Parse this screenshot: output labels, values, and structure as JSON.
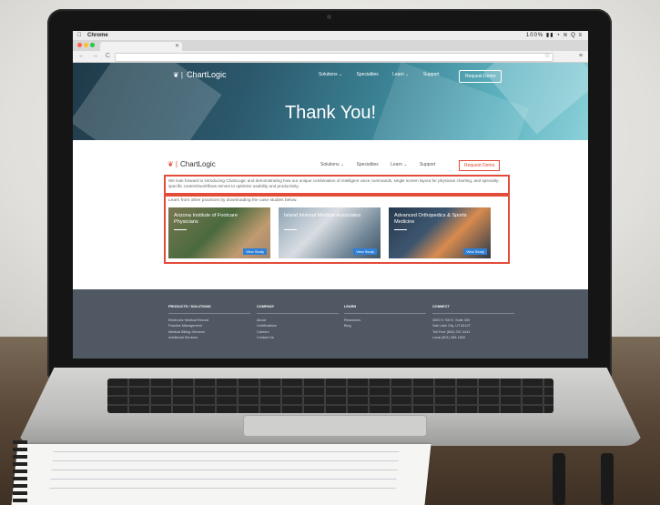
{
  "system": {
    "menubar_app": "Chrome",
    "status_text": "100% ▮▮ ◔ ≋ Q ≡"
  },
  "browser": {
    "tab_close_icon": "close-icon",
    "nav_icons": "← → C Q",
    "bookmark_icon": "star-icon",
    "menu_icon": "hamburger-icon"
  },
  "site": {
    "brand": "ChartLogic",
    "nav": [
      "Solutions ⌄",
      "Specialties",
      "Learn ⌄",
      "Support"
    ],
    "cta": "Request Demo",
    "hero_title": "Thank You!"
  },
  "inner_page": {
    "brand": "ChartLogic",
    "nav": [
      "Solutions ⌄",
      "Specialties",
      "Learn ⌄",
      "Support"
    ],
    "cta": "Request Demo",
    "intro": "We look forward to introducing ChartLogic and demonstrating how our unique combination of intelligent voice commands, single screen layout for physician charting, and specialty-specific content/workflows serves to optimize usability and productivity.",
    "lead": "Learn from other practices by downloading the case studies below.",
    "cards": [
      {
        "title": "Arizona Institute of Footcare Physicians",
        "cta": "View Study"
      },
      {
        "title": "Island Internal Medical Associates",
        "cta": "View Study"
      },
      {
        "title": "Advanced Orthopedics & Sports Medicine",
        "cta": "View Study"
      }
    ]
  },
  "footer": {
    "columns": [
      {
        "heading": "PRODUCTS / SOLUTIONS",
        "items": [
          "Electronic Medical Record",
          "Practice Management",
          "Medical Billing Services",
          "Additional Services"
        ]
      },
      {
        "heading": "COMPANY",
        "items": [
          "About",
          "Certifications",
          "Careers",
          "Contact Us"
        ]
      },
      {
        "heading": "LEARN",
        "items": [
          "Resources",
          "Blog"
        ]
      },
      {
        "heading": "CONNECT",
        "items": [
          "3000 S 700 E, Suite 300",
          "Salt Lake City, UT 84107",
          "Toll Free (800) 337-4441",
          "Local (801) 365-1800"
        ]
      }
    ]
  },
  "colors": {
    "accent_red": "#e34b3a",
    "hero_dark": "#1f3a49",
    "hero_light": "#8bd0d8",
    "footer_bg": "#4f5863",
    "button_blue": "#2f7fd6"
  }
}
